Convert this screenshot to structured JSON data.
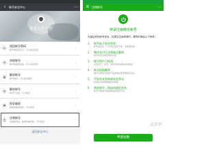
{
  "left": {
    "nav_title": "帐号安全中心",
    "banner_slogan": "安全上升一切",
    "items": [
      {
        "title": "找回帐号密码",
        "desc": "帐号或密码忘记，可以尝试找回"
      },
      {
        "title": "冻结帐号",
        "desc": "帐号被盗或丢失，可以冻结帐号"
      },
      {
        "title": "解封帐号",
        "desc": "帐号被封，可以尝试解封"
      },
      {
        "title": "解冻帐号",
        "desc": "帐号已冻结，可以解冻"
      },
      {
        "title": "投诉维权",
        "desc": "被骗或被侵权时，可以投诉"
      },
      {
        "title": "注销帐号",
        "desc": "注销帐号后，数据将被清除，不可恢复"
      }
    ],
    "footer_link": "返回安全中心"
  },
  "right": {
    "nav_title": "注销帐号",
    "header_title": "申请注销微信帐号",
    "intro": "为保证你的帐号安全，在提交注销申请时，需同时满足以下条件：",
    "conditions": [
      {
        "num": "1.",
        "title": "帐号处于安全状态",
        "desc": "帐号在最近一个月内无改密记录，无被盗风险"
      },
      {
        "num": "2.",
        "title": "微信支付已注销或已解除",
        "desc": "帐号中没有未完成的交易"
      },
      {
        "num": "3.",
        "title": "帐号财产已结清",
        "desc": "没有资产、欠款、未结清的资金和虚拟权益"
      },
      {
        "num": "4.",
        "title": "帐号权限解除",
        "desc": "帐号已解除与其他产品的授权登录或绑定关系"
      },
      {
        "num": "5.",
        "title": "不存在未完成或存在争议",
        "desc": "包括投诉举报或被投诉举报"
      },
      {
        "num": "6.",
        "title": "其他帐号，网站的绑定关系",
        "desc": "帐号已解除与其他网站的绑定关系"
      }
    ],
    "apply_button": "申请注销",
    "watermark": "APP"
  },
  "colors": {
    "wechat_green": "#1aad19",
    "nav_dark": "#393a3f",
    "highlight_red": "#e0252c"
  }
}
